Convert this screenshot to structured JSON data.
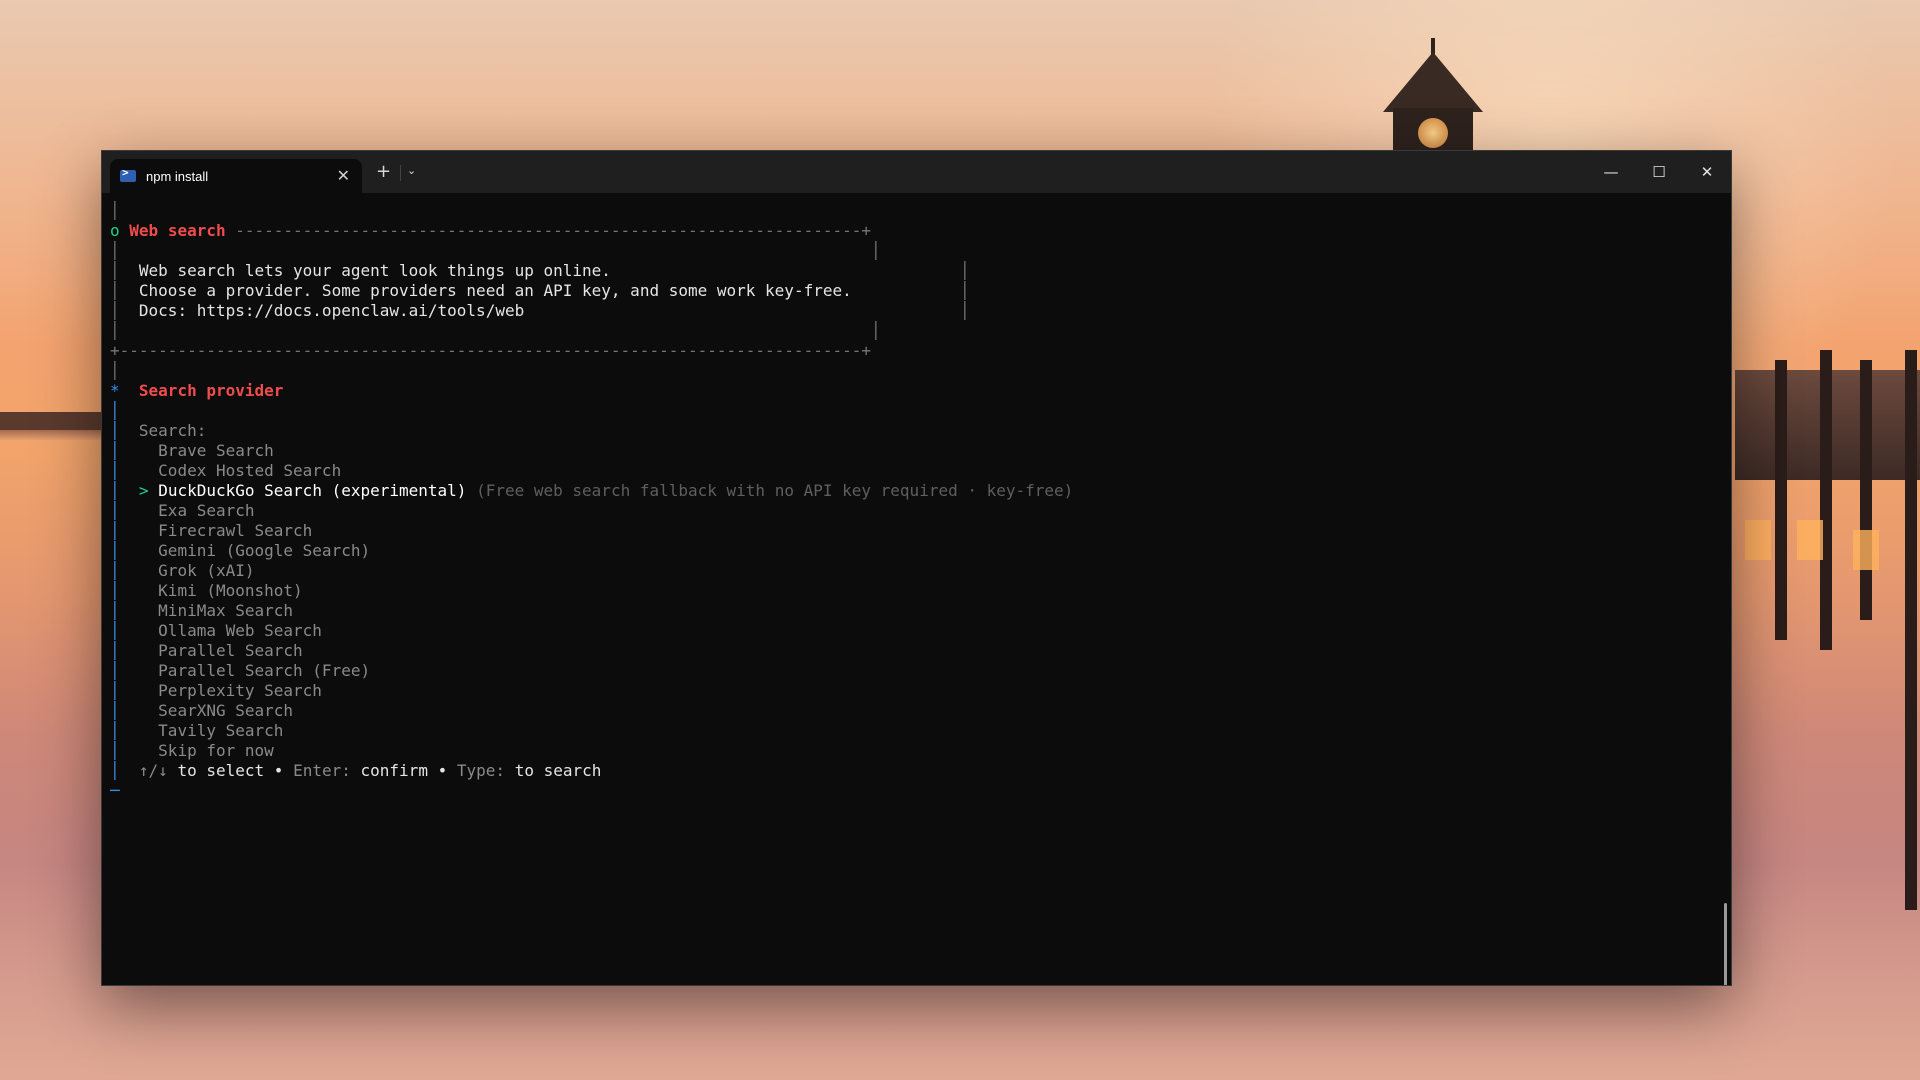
{
  "window": {
    "tab_title": "npm install",
    "tab_close": "✕",
    "new_tab": "+",
    "tab_menu": "⌄",
    "minimize": "—",
    "maximize": "☐",
    "close": "✕"
  },
  "terminal": {
    "web_search": {
      "marker": "o",
      "heading": "Web search",
      "rule": " -----------------------------------------------------------------+",
      "desc1": "Web search lets your agent look things up online.",
      "desc2": "Choose a provider. Some providers need an API key, and some work key-free.",
      "docs": "Docs: https://docs.openclaw.ai/tools/web",
      "bottom_rule": "+-----------------------------------------------------------------------------+"
    },
    "provider": {
      "marker": "*",
      "heading": "Search provider",
      "search_label": "Search:",
      "items": [
        "Brave Search",
        "Codex Hosted Search",
        "DuckDuckGo Search (experimental)",
        "Exa Search",
        "Firecrawl Search",
        "Gemini (Google Search)",
        "Grok (xAI)",
        "Kimi (Moonshot)",
        "MiniMax Search",
        "Ollama Web Search",
        "Parallel Search",
        "Parallel Search (Free)",
        "Perplexity Search",
        "SearXNG Search",
        "Tavily Search",
        "Skip for now"
      ],
      "selected_index": 2,
      "selected_arrow": ">",
      "selected_hint": "(Free web search fallback with no API key required · key-free)"
    },
    "help": {
      "keys": "↑/↓",
      "select": "to select",
      "bullet": "•",
      "enter_label": "Enter:",
      "confirm": "confirm",
      "type_label": "Type:",
      "to_search": "to search"
    }
  }
}
